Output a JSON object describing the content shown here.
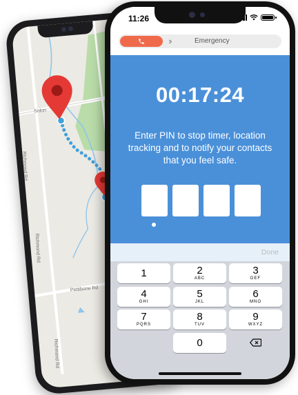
{
  "status_bar": {
    "time": "11:26"
  },
  "tabs": {
    "emergency_label": "Emergency"
  },
  "timer": {
    "value": "00:17:24"
  },
  "message": "Enter PIN to stop timer, location tracking and to notify your contacts that you feel safe.",
  "pin": {
    "length": 4
  },
  "keyboard": {
    "done_label": "Done",
    "keys": [
      {
        "num": "1",
        "sub": ""
      },
      {
        "num": "2",
        "sub": "ABC"
      },
      {
        "num": "3",
        "sub": "DEF"
      },
      {
        "num": "4",
        "sub": "GHI"
      },
      {
        "num": "5",
        "sub": "JKL"
      },
      {
        "num": "6",
        "sub": "MNO"
      },
      {
        "num": "7",
        "sub": "PQRS"
      },
      {
        "num": "8",
        "sub": "TUV"
      },
      {
        "num": "9",
        "sub": "WXYZ"
      },
      {
        "num": "0",
        "sub": ""
      }
    ]
  },
  "map": {
    "labels": {
      "solon": "Solon",
      "richmond_1": "Richmond Rd",
      "richmond_2": "Richmond Rd",
      "richmond_3": "Richmond Rd",
      "pettibone": "Pettibone Rd"
    }
  },
  "colors": {
    "accent": "#ef6a4b",
    "panel_blue": "#4a90d9",
    "pin_red": "#e53935",
    "route_blue": "#3fa0dc",
    "park_green": "#b9dca9"
  }
}
